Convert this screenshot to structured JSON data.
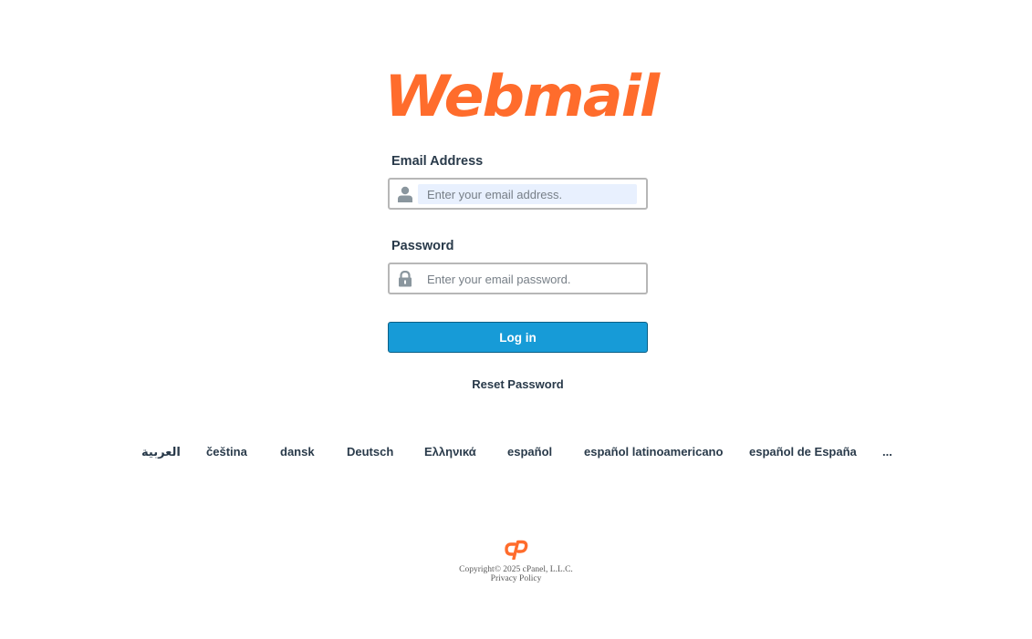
{
  "brand": {
    "logo_text": "Webmail",
    "accent_color": "#ff6c2c",
    "button_color": "#179bd7",
    "text_color": "#293a4a"
  },
  "login": {
    "email_label": "Email Address",
    "email_placeholder": "Enter your email address.",
    "email_icon": "user-icon",
    "password_label": "Password",
    "password_placeholder": "Enter your email password.",
    "password_icon": "lock-icon",
    "login_button": "Log in",
    "reset_password": "Reset Password"
  },
  "languages": [
    "العربية",
    "čeština",
    "dansk",
    "Deutsch",
    "Ελληνικά",
    "español",
    "español latinoamericano",
    "español de España"
  ],
  "languages_more": "...",
  "footer": {
    "logo": "cpanel-logo",
    "copyright": "Copyright© 2025 cPanel, L.L.C.",
    "privacy_policy": "Privacy Policy"
  }
}
